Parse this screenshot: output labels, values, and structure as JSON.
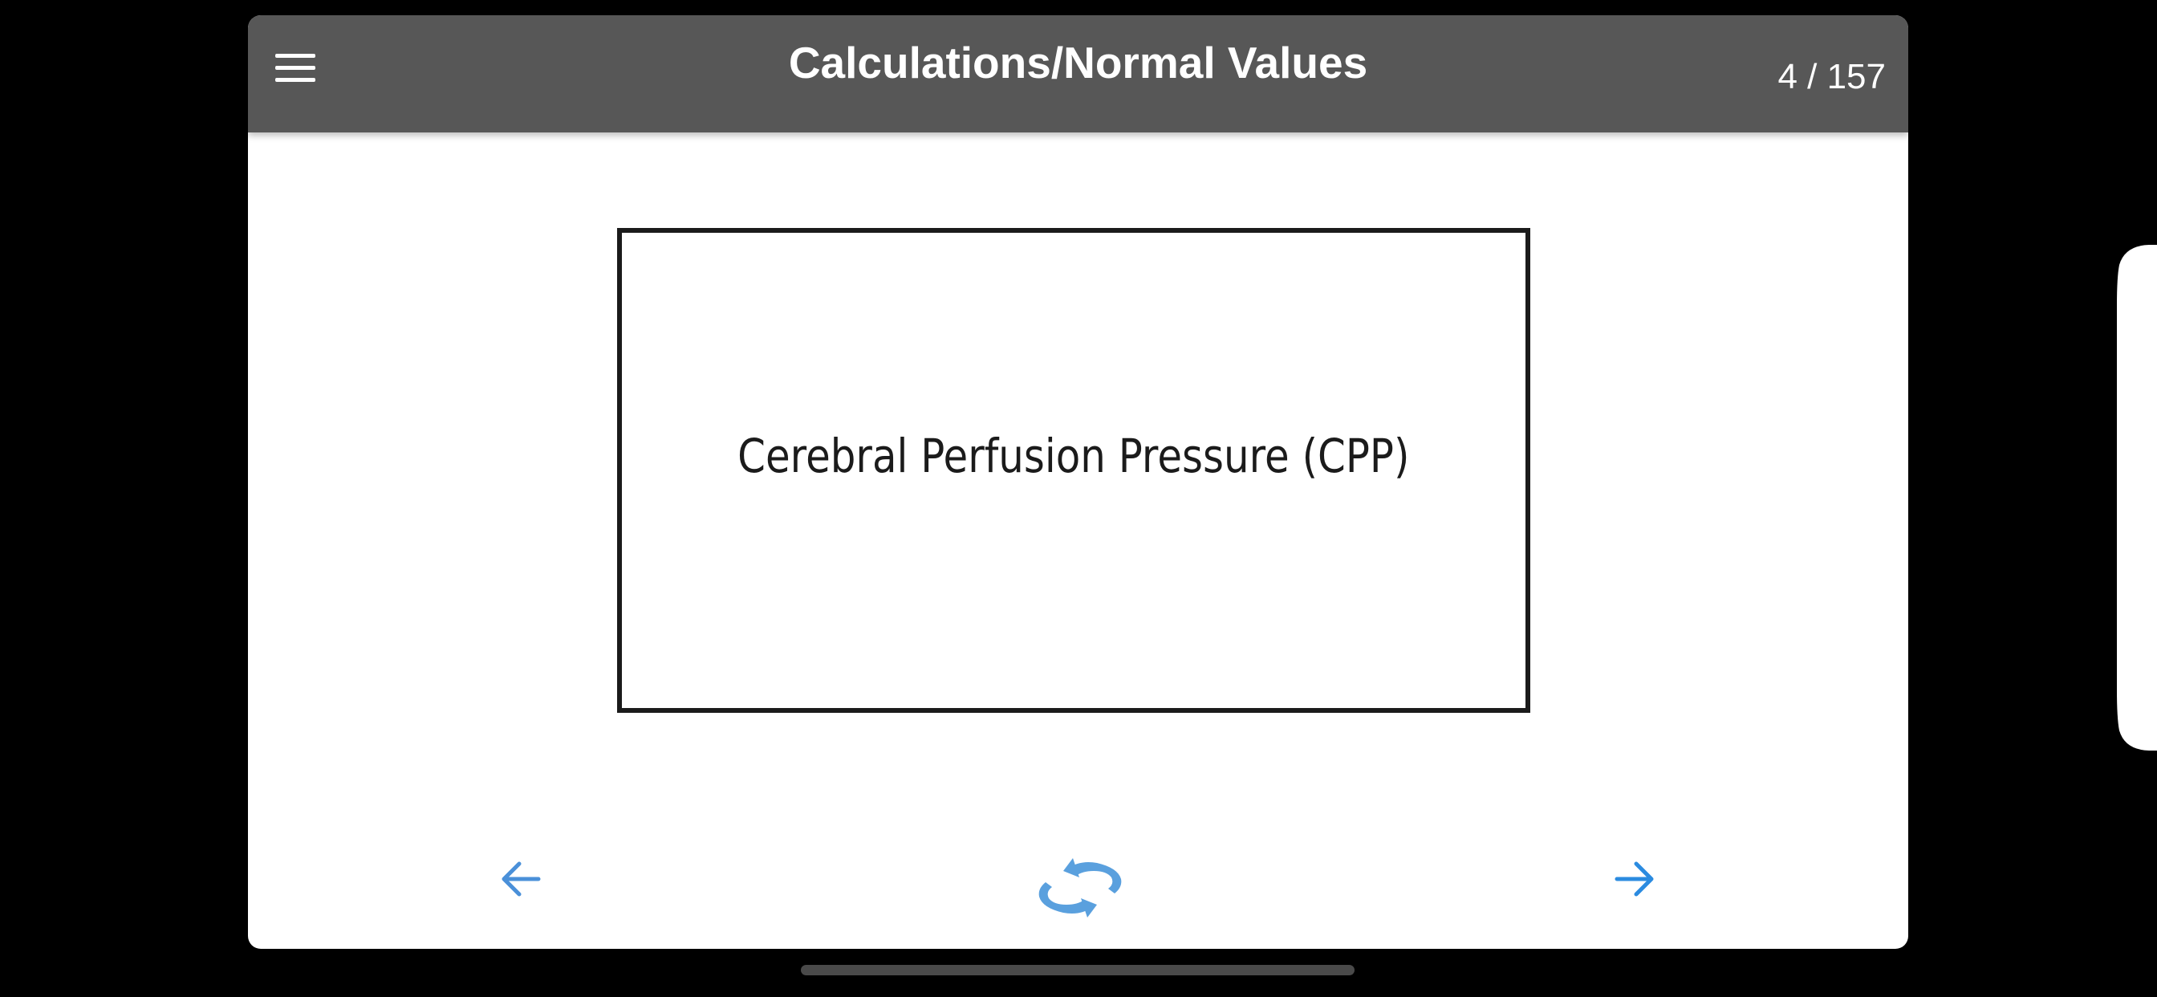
{
  "header": {
    "title": "Calculations/Normal Values",
    "counter": "4 / 157"
  },
  "card": {
    "front_text": "Cerebral Perfusion Pressure (CPP)"
  },
  "icons": {
    "menu": "hamburger-menu-icon",
    "prev": "arrow-left-icon",
    "flip": "refresh-flip-icon",
    "next": "arrow-right-icon"
  },
  "colors": {
    "app_bar": "#575757",
    "accent": "#4a90d9",
    "flip_icon": "#5aa0de"
  }
}
